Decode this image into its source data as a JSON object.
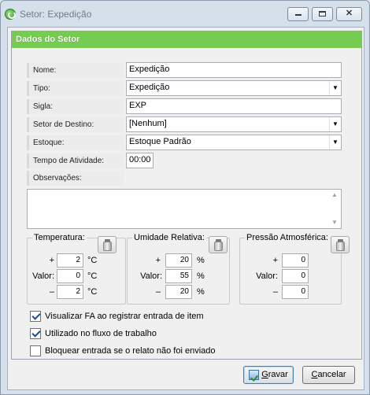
{
  "window": {
    "title": "Setor: Expedição"
  },
  "panel": {
    "title": "Dados do Setor"
  },
  "fields": {
    "nome": {
      "label": "Nome:",
      "value": "Expedição"
    },
    "tipo": {
      "label": "Tipo:",
      "value": "Expedição"
    },
    "sigla": {
      "label": "Sigla:",
      "value": "EXP"
    },
    "setor_destino": {
      "label": "Setor de Destino:",
      "value": "[Nenhum]"
    },
    "estoque": {
      "label": "Estoque:",
      "value": "Estoque Padrão"
    },
    "tempo": {
      "label": "Tempo de Atividade:",
      "value": "00:00"
    },
    "observacoes": {
      "label": "Observações:",
      "value": ""
    }
  },
  "groups": {
    "temperatura": {
      "title": "Temperatura:",
      "plus_label": "+",
      "valor_label": "Valor:",
      "minus_label": "–",
      "plus": "2",
      "valor": "0",
      "minus": "2",
      "unit": "°C"
    },
    "umidade": {
      "title": "Umidade Relativa:",
      "plus_label": "+",
      "valor_label": "Valor:",
      "minus_label": "–",
      "plus": "20",
      "valor": "55",
      "minus": "20",
      "unit": "%"
    },
    "pressao": {
      "title": "Pressão Atmosférica:",
      "plus_label": "+",
      "valor_label": "Valor:",
      "minus_label": "–",
      "plus": "0",
      "valor": "0",
      "minus": "0"
    }
  },
  "checks": [
    {
      "label": "Visualizar FA ao registrar entrada de item",
      "checked": true
    },
    {
      "label": "Utilizado no fluxo de trabalho",
      "checked": true
    },
    {
      "label": "Bloquear entrada se o relato não foi enviado",
      "checked": false
    }
  ],
  "buttons": {
    "save_accel": "G",
    "save_rest": "ravar",
    "cancel_accel": "C",
    "cancel_rest": "ancelar"
  },
  "colors": {
    "header": "#76cc50",
    "window": "#d6e0ea"
  },
  "icons": {
    "app": "app-icon",
    "gauge": "thermometer-icon",
    "save": "save-icon"
  }
}
